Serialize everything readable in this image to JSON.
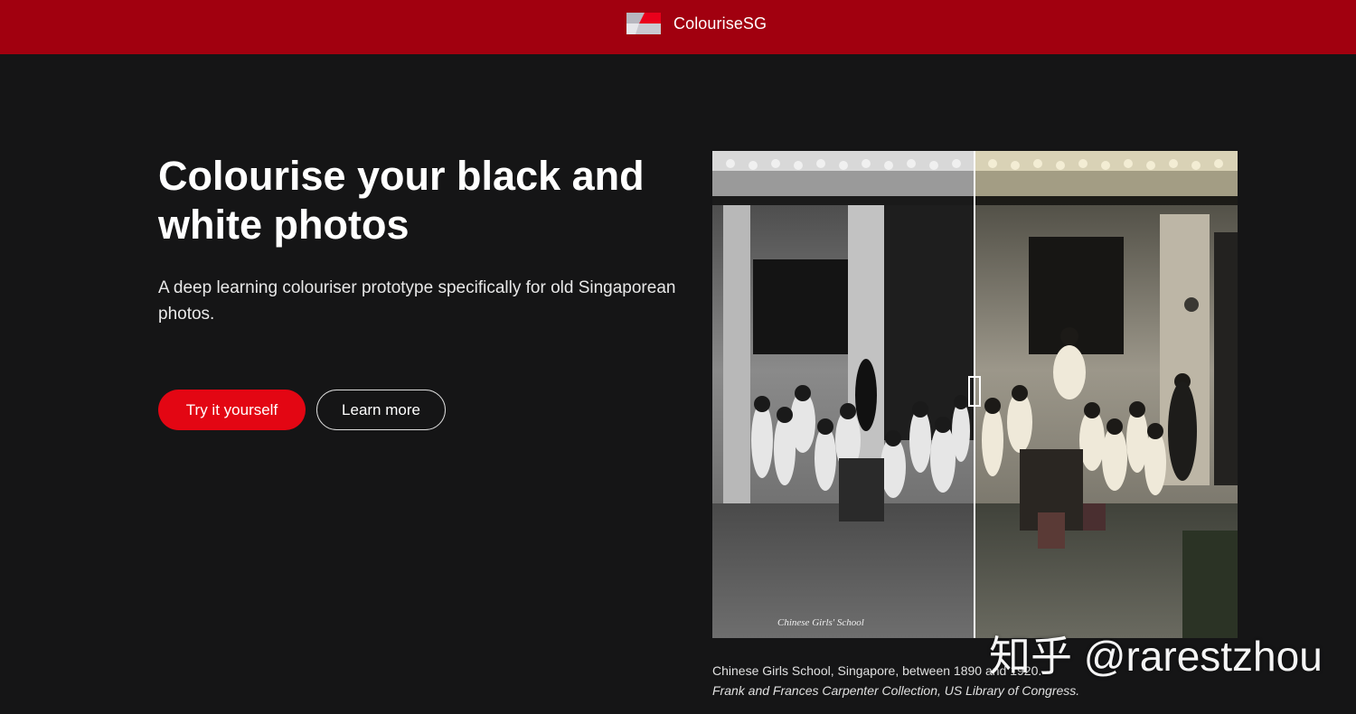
{
  "header": {
    "brand_name": "ColouriseSG",
    "logo_icon": "flag-logo-icon",
    "background_color": "#a1000f"
  },
  "hero": {
    "title": "Colourise your black and white photos",
    "subtitle": "A deep learning colouriser prototype specifically for old Singaporean photos.",
    "primary_button_label": "Try it yourself",
    "secondary_button_label": "Learn more",
    "primary_button_color": "#e30613"
  },
  "comparison": {
    "divider_position": 0.5,
    "handle_icon": "slider-handle-icon",
    "photo_inscription": "Chinese Girls' School"
  },
  "caption": {
    "line1": "Chinese Girls School, Singapore, between 1890 and 1920.",
    "line2": "Frank and Frances Carpenter Collection, US Library of Congress."
  },
  "watermark": {
    "text": "知乎 @rarestzhou"
  }
}
